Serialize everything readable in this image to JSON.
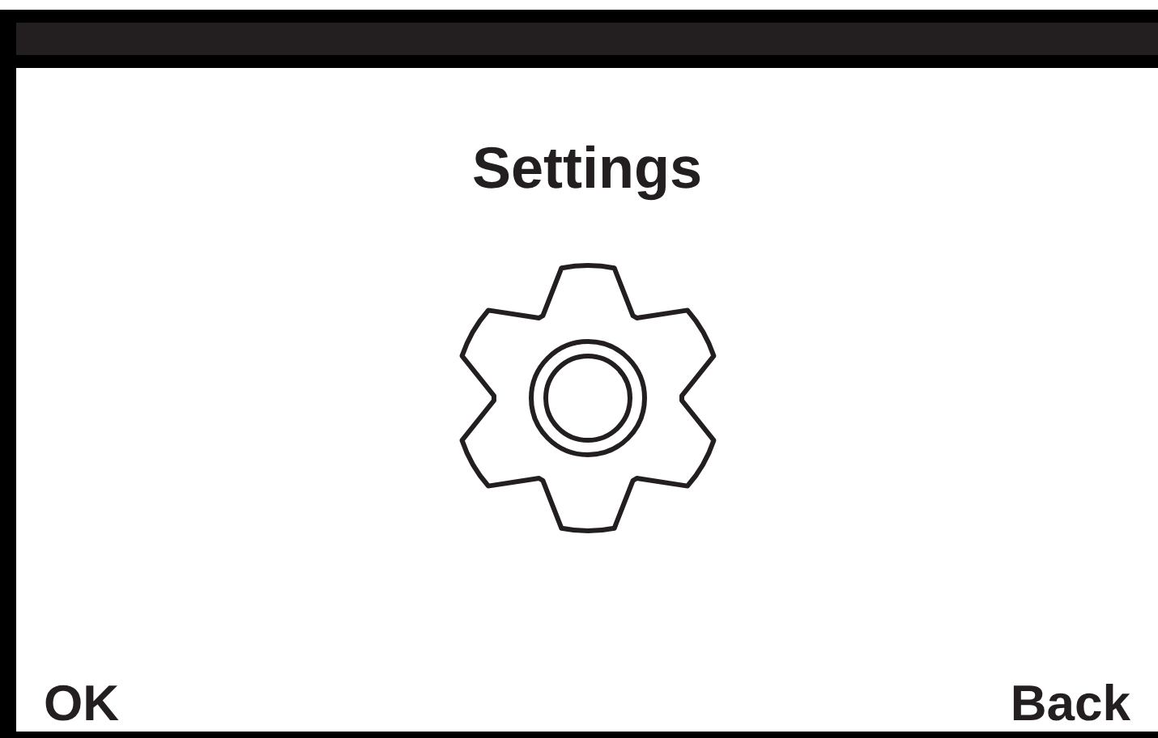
{
  "screen": {
    "title": "Settings"
  },
  "softkeys": [
    {
      "label": "OK"
    },
    {
      "label": "Back"
    }
  ]
}
